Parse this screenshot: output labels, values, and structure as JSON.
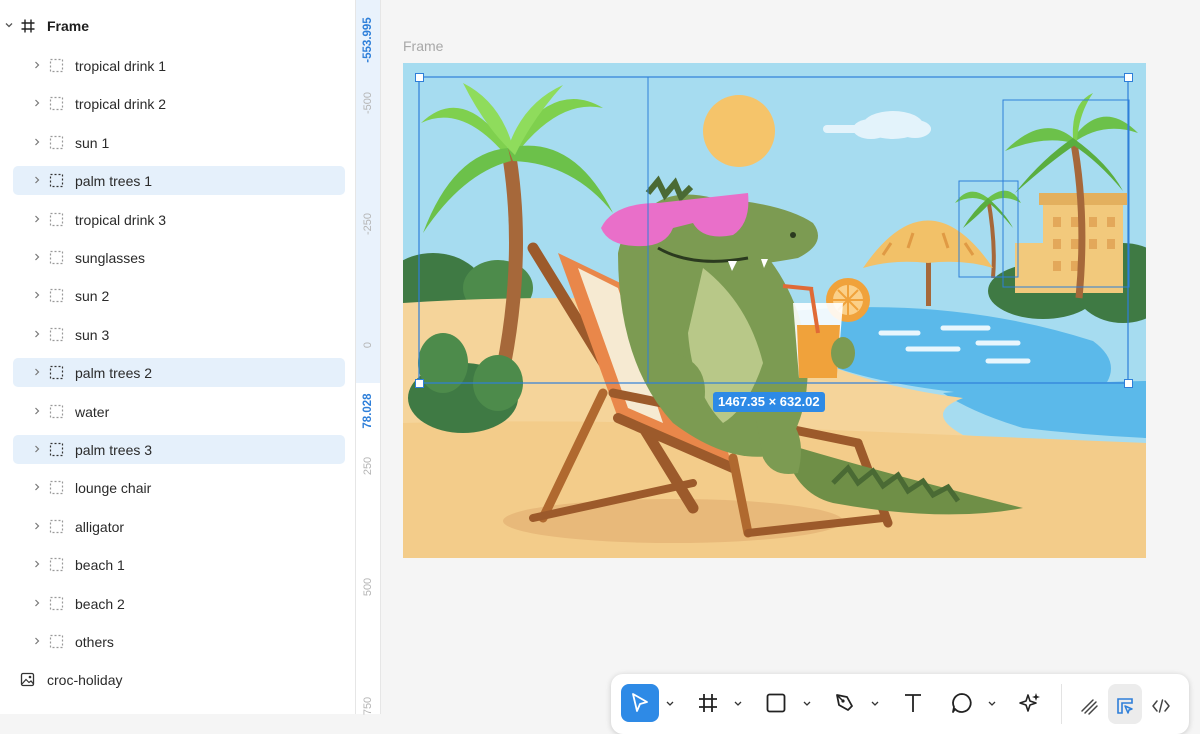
{
  "layers_panel": {
    "frame": {
      "label": "Frame",
      "icon": "frame-icon"
    },
    "items": [
      {
        "label": "tropical drink 1",
        "selected": false
      },
      {
        "label": "tropical drink 2",
        "selected": false
      },
      {
        "label": "sun 1",
        "selected": false
      },
      {
        "label": "palm trees 1",
        "selected": true
      },
      {
        "label": "tropical drink 3",
        "selected": false
      },
      {
        "label": "sunglasses",
        "selected": false
      },
      {
        "label": "sun 2",
        "selected": false
      },
      {
        "label": "sun 3",
        "selected": false
      },
      {
        "label": "palm trees 2",
        "selected": true
      },
      {
        "label": "water",
        "selected": false
      },
      {
        "label": "palm trees 3",
        "selected": true
      },
      {
        "label": "lounge chair",
        "selected": false
      },
      {
        "label": "alligator",
        "selected": false
      },
      {
        "label": "beach 1",
        "selected": false
      },
      {
        "label": "beach 2",
        "selected": false
      },
      {
        "label": "others",
        "selected": false
      }
    ],
    "image_layer": {
      "label": "croc-holiday",
      "icon": "image-icon"
    }
  },
  "ruler": {
    "selection_start": "-553.995",
    "selection_end": "78.028",
    "ticks": [
      "-500",
      "-250",
      "0",
      "250",
      "500",
      "750"
    ]
  },
  "canvas": {
    "frame_title": "Frame",
    "selection_size": "1467.35 × 632.02",
    "accent_color": "#2e8ae6"
  },
  "toolbar": {
    "tools": [
      {
        "name": "move-tool",
        "icon": "cursor-icon",
        "active": true
      },
      {
        "name": "frame-tool",
        "icon": "hash-icon",
        "active": false
      },
      {
        "name": "rectangle-tool",
        "icon": "square-icon",
        "active": false
      },
      {
        "name": "pen-tool",
        "icon": "pen-icon",
        "active": false
      },
      {
        "name": "text-tool",
        "icon": "text-icon",
        "active": false
      },
      {
        "name": "comment-tool",
        "icon": "comment-icon",
        "active": false
      },
      {
        "name": "ai-tool",
        "icon": "sparkle-icon",
        "active": false
      }
    ],
    "modes": [
      {
        "name": "draw-mode",
        "icon": "scribble-icon",
        "active": false
      },
      {
        "name": "design-mode",
        "icon": "design-icon",
        "active": true
      },
      {
        "name": "dev-mode",
        "icon": "code-icon",
        "active": false
      }
    ]
  }
}
